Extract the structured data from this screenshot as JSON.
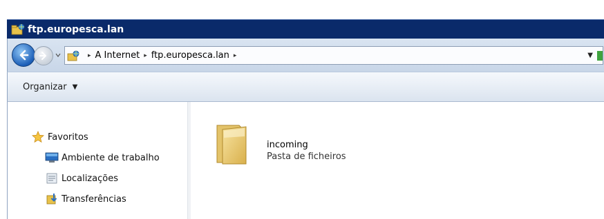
{
  "window": {
    "title": "ftp.europesca.lan"
  },
  "address_bar": {
    "crumbs": [
      "A Internet",
      "ftp.europesca.lan"
    ]
  },
  "command_bar": {
    "organize_label": "Organizar"
  },
  "nav_pane": {
    "favorites_label": "Favoritos",
    "items": [
      {
        "label": "Ambiente de trabalho",
        "icon": "desktop-icon"
      },
      {
        "label": "Localizações",
        "icon": "recent-places-icon"
      },
      {
        "label": "Transferências",
        "icon": "downloads-icon"
      }
    ]
  },
  "content": {
    "items": [
      {
        "name": "incoming",
        "type": "Pasta de ficheiros",
        "icon": "folder-icon"
      }
    ]
  },
  "colors": {
    "titlebar": "#0a2a6a",
    "toolbar": "#d9e4f1",
    "folder": "#f2d27a"
  }
}
